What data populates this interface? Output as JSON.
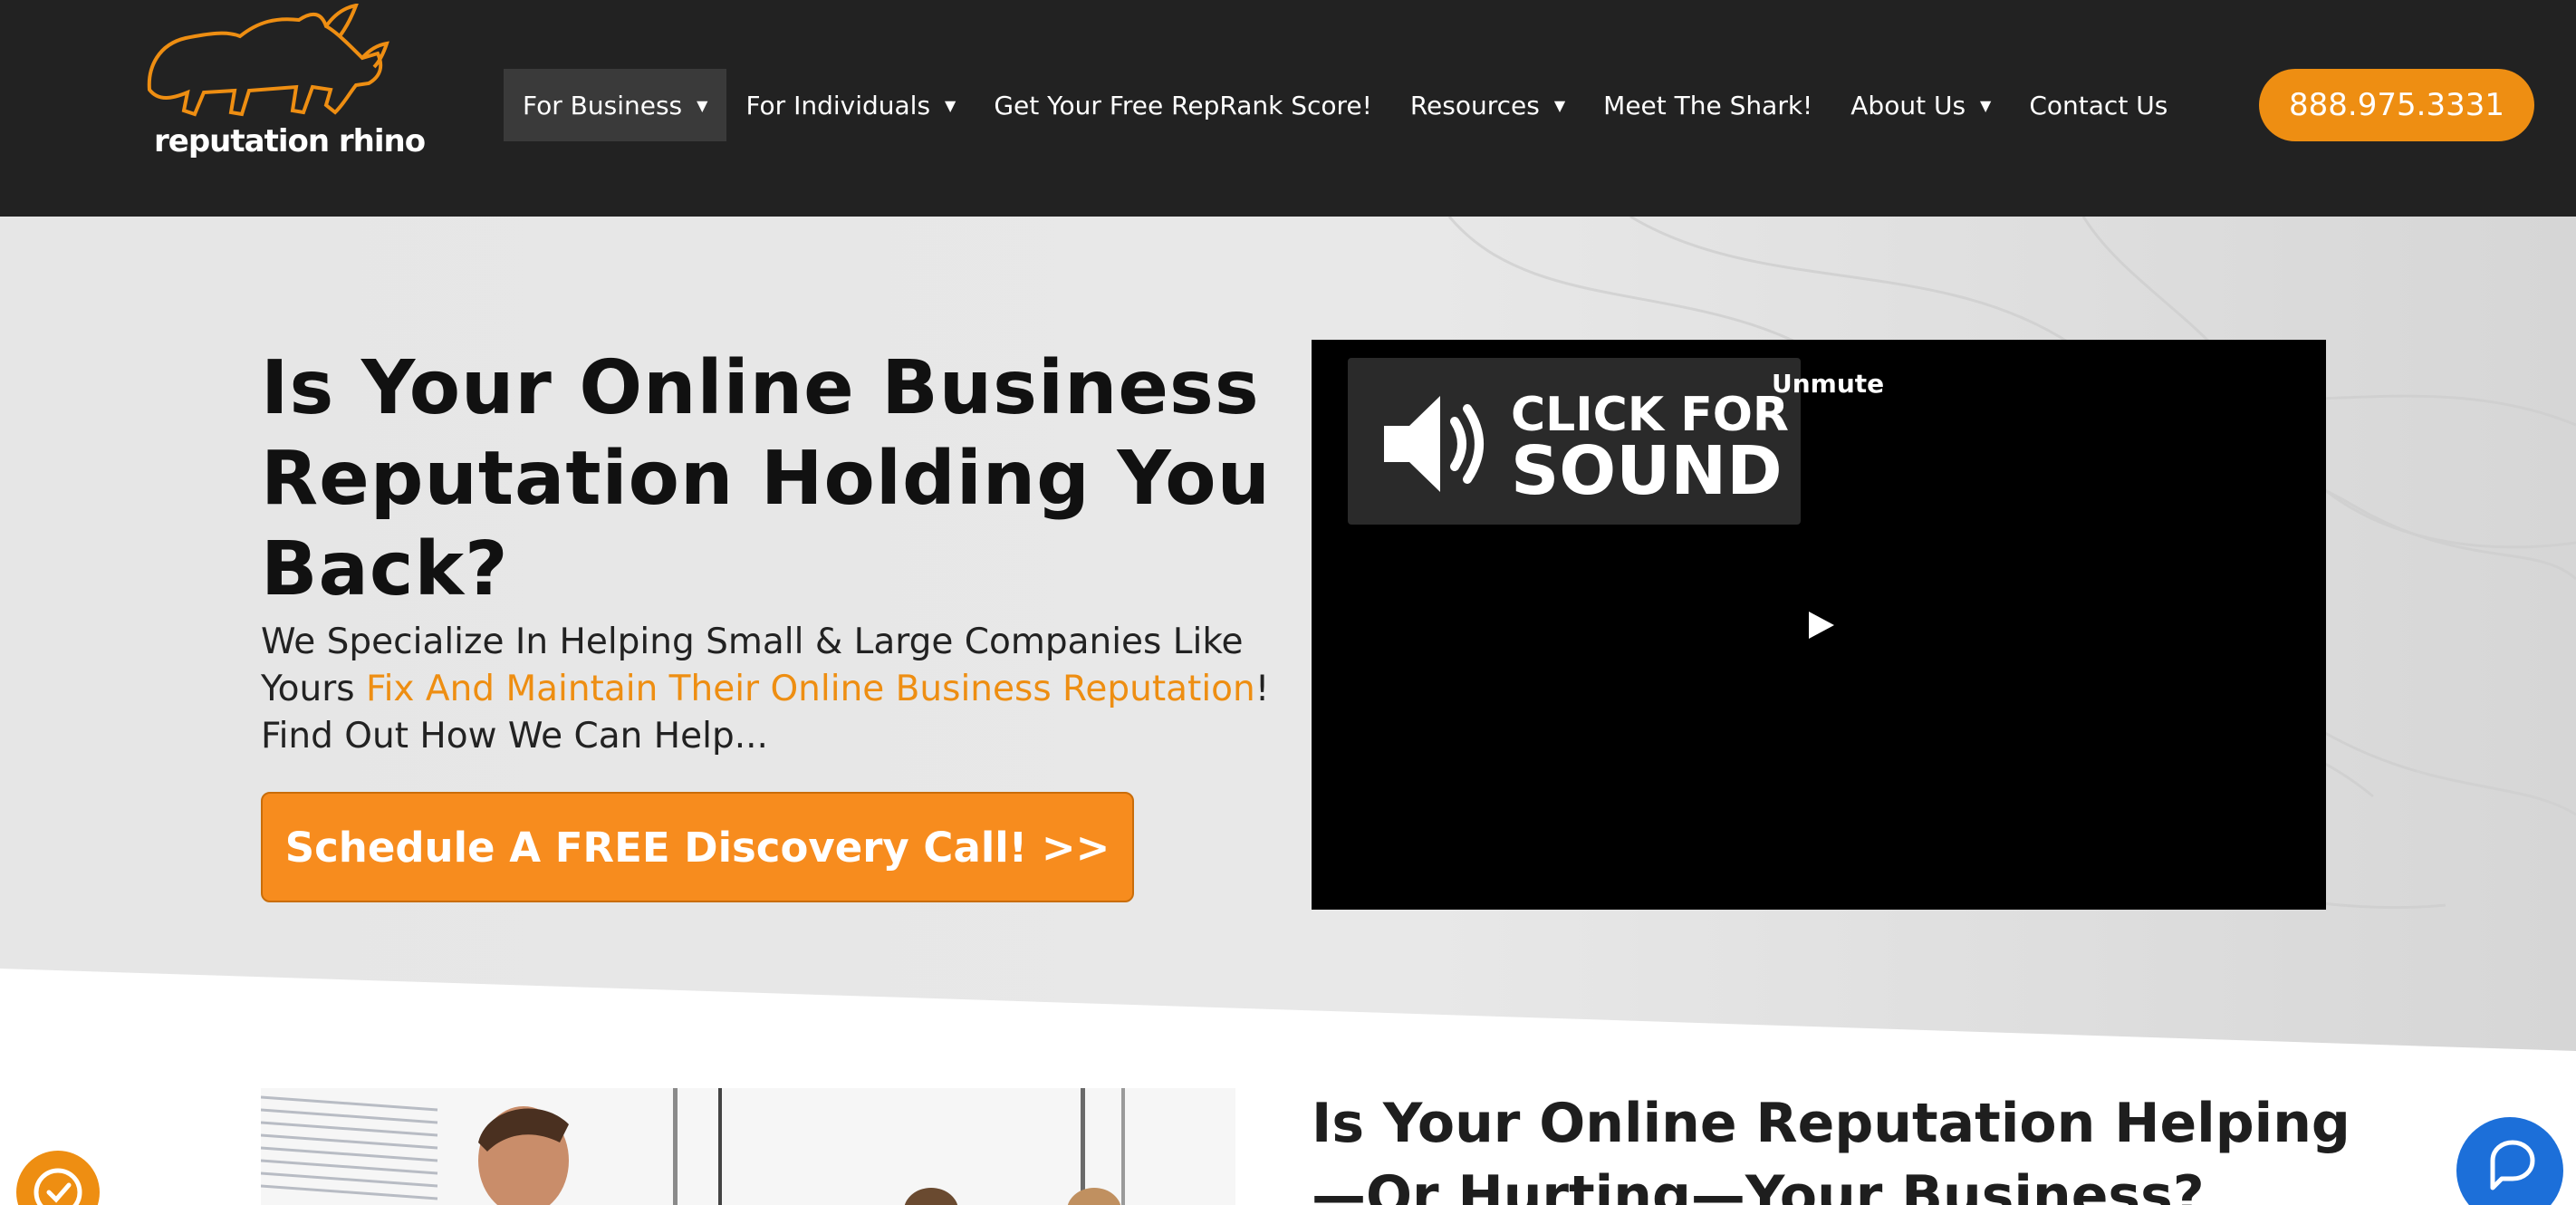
{
  "brand": {
    "logo_text": "reputation rhino",
    "accent_color": "#ee8e12"
  },
  "nav": {
    "items": [
      {
        "label": "For Business",
        "dropdown": true,
        "active": true
      },
      {
        "label": "For Individuals",
        "dropdown": true
      },
      {
        "label": "Get Your Free RepRank Score!",
        "dropdown": false
      },
      {
        "label": "Resources",
        "dropdown": true
      },
      {
        "label": "Meet The Shark!",
        "dropdown": false
      },
      {
        "label": "About Us",
        "dropdown": true
      },
      {
        "label": "Contact Us",
        "dropdown": false
      }
    ],
    "phone": "888.975.3331"
  },
  "hero": {
    "title": "Is Your Online Business Reputation Holding You Back?",
    "subtitle_before": "We Specialize In Helping Small & Large Companies Like Yours ",
    "subtitle_highlight": "Fix And Maintain Their Online Business Reputation",
    "subtitle_after": "!  Find Out How We Can Help...",
    "cta_label": "Schedule A FREE Discovery Call! >>"
  },
  "video": {
    "click_line1": "CLICK FOR",
    "click_line2": "SOUND",
    "unmute_label": "Unmute",
    "icons": [
      "speaker-icon",
      "play-icon"
    ]
  },
  "section2": {
    "title": "Is Your Online Reputation Helping—Or Hurting—Your Business?"
  },
  "widgets": {
    "chat_icon": "chat-icon",
    "badge_icon": "clock-check-icon"
  }
}
